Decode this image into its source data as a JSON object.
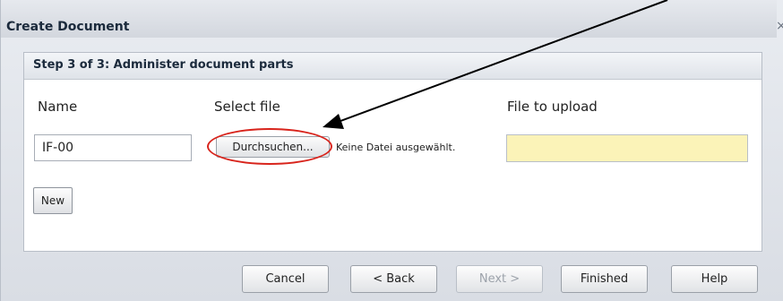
{
  "dialog": {
    "title": "Create Document",
    "close_glyph": "×"
  },
  "panel": {
    "title": "Step 3 of 3: Administer document parts",
    "columns": {
      "name": "Name",
      "select_file": "Select file",
      "file_to_upload": "File to upload"
    },
    "name_value": "IF-00",
    "browse_label": "Durchsuchen...",
    "no_file_text": "Keine Datei ausgewählt.",
    "new_label": "New"
  },
  "footer": {
    "cancel": "Cancel",
    "back": "< Back",
    "next": "Next >",
    "finished": "Finished",
    "help": "Help"
  },
  "colors": {
    "annotation": "#d8241c",
    "upload_field_bg": "#fbf3b8"
  },
  "icons": {
    "close": "close-icon",
    "annotation_arrow": "arrow-annotation-icon"
  }
}
